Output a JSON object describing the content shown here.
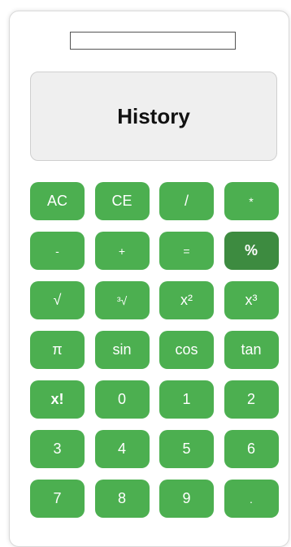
{
  "display": {
    "value": "",
    "placeholder": ""
  },
  "history": {
    "label": "History"
  },
  "colors": {
    "key_bg": "#4caf50",
    "key_active_bg": "#3d8b40",
    "key_text": "#ffffff",
    "history_bg": "#efefef"
  },
  "keys": [
    {
      "label": "AC",
      "icon": "",
      "state": "normal"
    },
    {
      "label": "CE",
      "icon": "",
      "state": "normal"
    },
    {
      "label": "/",
      "icon": "",
      "state": "normal"
    },
    {
      "label": "*",
      "icon": "",
      "state": "normal"
    },
    {
      "label": "-",
      "icon": "",
      "state": "normal"
    },
    {
      "label": "+",
      "icon": "",
      "state": "normal"
    },
    {
      "label": "=",
      "icon": "",
      "state": "normal"
    },
    {
      "label": "%",
      "icon": "",
      "state": "hovered"
    },
    {
      "label": "√",
      "icon": "square-root-icon",
      "state": "normal"
    },
    {
      "label": "³√",
      "icon": "cube-root-icon",
      "state": "normal"
    },
    {
      "label": "x²",
      "icon": "",
      "state": "normal"
    },
    {
      "label": "x³",
      "icon": "",
      "state": "normal"
    },
    {
      "label": "π",
      "icon": "pi-icon",
      "state": "normal"
    },
    {
      "label": "sin",
      "icon": "",
      "state": "normal"
    },
    {
      "label": "cos",
      "icon": "",
      "state": "normal"
    },
    {
      "label": "tan",
      "icon": "",
      "state": "normal"
    },
    {
      "label": "x!",
      "icon": "",
      "state": "normal"
    },
    {
      "label": "0",
      "icon": "",
      "state": "normal"
    },
    {
      "label": "1",
      "icon": "",
      "state": "normal"
    },
    {
      "label": "2",
      "icon": "",
      "state": "normal"
    },
    {
      "label": "3",
      "icon": "",
      "state": "normal"
    },
    {
      "label": "4",
      "icon": "",
      "state": "normal"
    },
    {
      "label": "5",
      "icon": "",
      "state": "normal"
    },
    {
      "label": "6",
      "icon": "",
      "state": "normal"
    },
    {
      "label": "7",
      "icon": "",
      "state": "normal"
    },
    {
      "label": "8",
      "icon": "",
      "state": "normal"
    },
    {
      "label": "9",
      "icon": "",
      "state": "normal"
    },
    {
      "label": ".",
      "icon": "",
      "state": "normal"
    }
  ]
}
